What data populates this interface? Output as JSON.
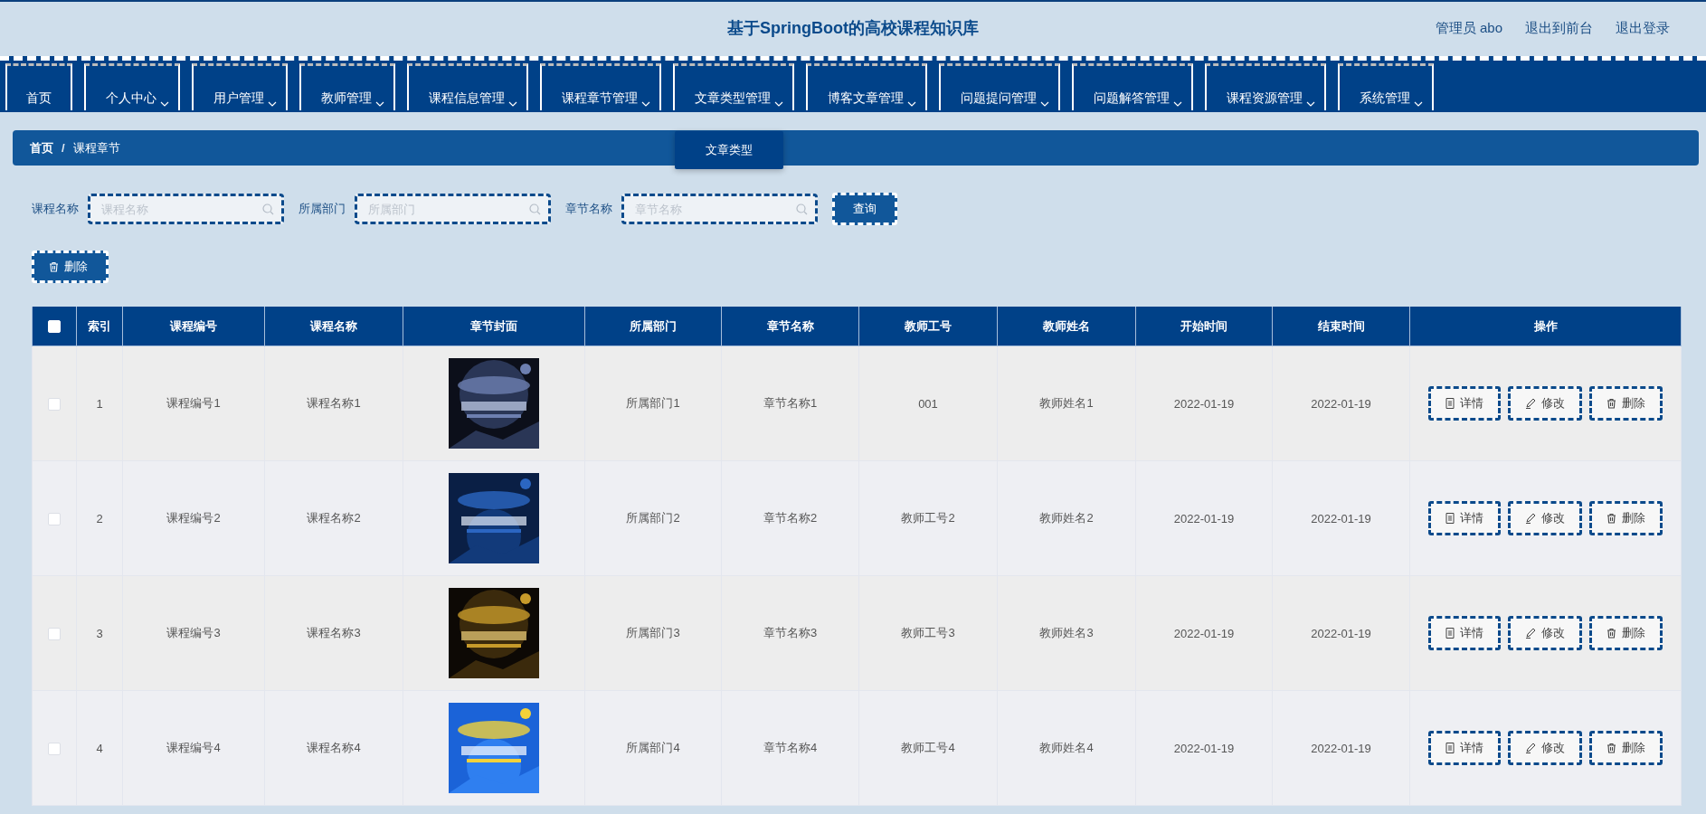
{
  "header": {
    "title": "基于SpringBoot的高校课程知识库",
    "links": [
      "管理员 abo",
      "退出到前台",
      "退出登录"
    ]
  },
  "nav": [
    {
      "label": "首页",
      "dropdown": false
    },
    {
      "label": "个人中心",
      "dropdown": true
    },
    {
      "label": "用户管理",
      "dropdown": true
    },
    {
      "label": "教师管理",
      "dropdown": true
    },
    {
      "label": "课程信息管理",
      "dropdown": true
    },
    {
      "label": "课程章节管理",
      "dropdown": true
    },
    {
      "label": "文章类型管理",
      "dropdown": true,
      "menu": [
        "文章类型"
      ]
    },
    {
      "label": "博客文章管理",
      "dropdown": true
    },
    {
      "label": "问题提问管理",
      "dropdown": true
    },
    {
      "label": "问题解答管理",
      "dropdown": true
    },
    {
      "label": "课程资源管理",
      "dropdown": true
    },
    {
      "label": "系统管理",
      "dropdown": true
    }
  ],
  "breadcrumb": {
    "items": [
      "首页",
      "课程章节"
    ],
    "separator": "/"
  },
  "search": {
    "fields": [
      {
        "label": "课程名称",
        "placeholder": "课程名称"
      },
      {
        "label": "所属部门",
        "placeholder": "所属部门"
      },
      {
        "label": "章节名称",
        "placeholder": "章节名称"
      }
    ],
    "button": "查询"
  },
  "delete_button": "删除",
  "table": {
    "select_all": {
      "checked": false
    },
    "columns": [
      {
        "label": "索引",
        "kind": "text"
      },
      {
        "label": "课程编号",
        "kind": "text"
      },
      {
        "label": "课程名称",
        "kind": "text"
      },
      {
        "label": "章节封面",
        "kind": "picture"
      },
      {
        "label": "所属部门",
        "kind": "text"
      },
      {
        "label": "章节名称",
        "kind": "text"
      },
      {
        "label": "教师工号",
        "kind": "text"
      },
      {
        "label": "教师姓名",
        "kind": "text"
      },
      {
        "label": "开始时间",
        "kind": "text"
      },
      {
        "label": "结束时间",
        "kind": "text"
      },
      {
        "label": "操作",
        "kind": "actions"
      }
    ],
    "rows": [
      {
        "checked": false,
        "cells": [
          "1",
          "课程编号1",
          "课程名称1",
          "",
          "所属部门1",
          "章节名称1",
          "001",
          "教师姓名1",
          "2022-01-19",
          "2022-01-19"
        ],
        "actions": [
          {
            "label": "详情",
            "kind": "detail"
          },
          {
            "label": "修改",
            "kind": "edit"
          },
          {
            "label": "删除",
            "kind": "delete"
          }
        ]
      },
      {
        "checked": false,
        "cells": [
          "2",
          "课程编号2",
          "课程名称2",
          "",
          "所属部门2",
          "章节名称2",
          "教师工号2",
          "教师姓名2",
          "2022-01-19",
          "2022-01-19"
        ],
        "actions": [
          {
            "label": "详情",
            "kind": "detail"
          },
          {
            "label": "修改",
            "kind": "edit"
          },
          {
            "label": "删除",
            "kind": "delete"
          }
        ]
      },
      {
        "checked": false,
        "cells": [
          "3",
          "课程编号3",
          "课程名称3",
          "",
          "所属部门3",
          "章节名称3",
          "教师工号3",
          "教师姓名3",
          "2022-01-19",
          "2022-01-19"
        ],
        "actions": [
          {
            "label": "详情",
            "kind": "detail"
          },
          {
            "label": "修改",
            "kind": "edit"
          },
          {
            "label": "删除",
            "kind": "delete"
          }
        ]
      },
      {
        "checked": false,
        "cells": [
          "4",
          "课程编号4",
          "课程名称4",
          "",
          "所属部门4",
          "章节名称4",
          "教师工号4",
          "教师姓名4",
          "2022-01-19",
          "2022-01-19"
        ],
        "actions": [
          {
            "label": "详情",
            "kind": "detail"
          },
          {
            "label": "修改",
            "kind": "edit"
          },
          {
            "label": "删除",
            "kind": "delete"
          }
        ]
      }
    ]
  }
}
